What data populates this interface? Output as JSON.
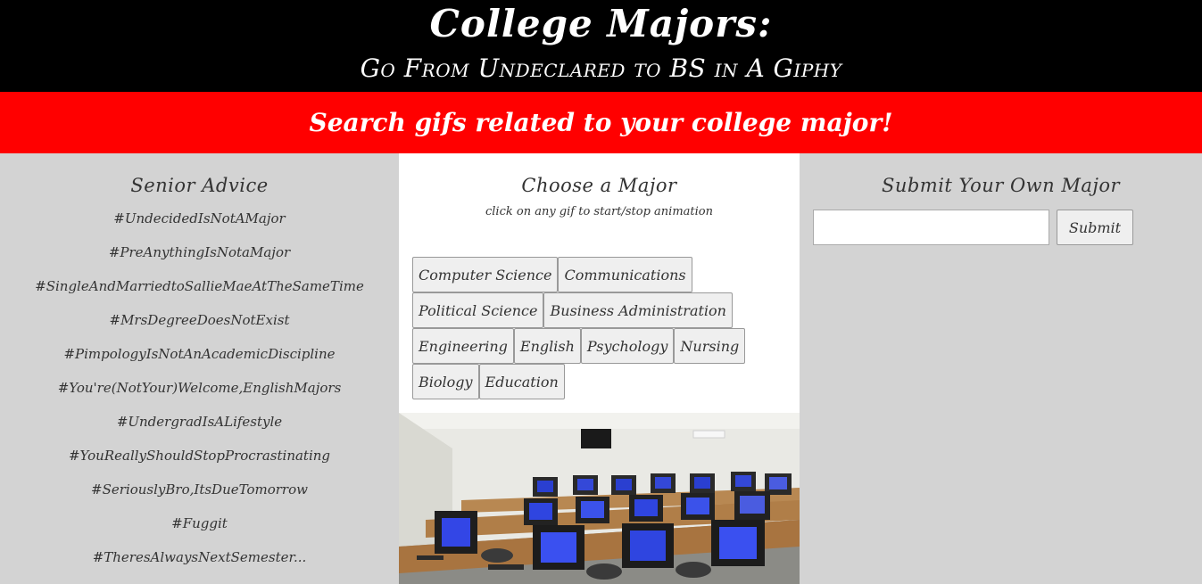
{
  "header": {
    "title": "College Majors:",
    "subtitle": "Go From Undeclared to BS in A Giphy"
  },
  "banner": {
    "text": "Search gifs related to your college major!"
  },
  "advice": {
    "heading": "Senior Advice",
    "items": [
      "#UndecidedIsNotAMajor",
      "#PreAnythingIsNotaMajor",
      "#SingleAndMarriedtoSallieMaeAtTheSameTime",
      "#MrsDegreeDoesNotExist",
      "#PimpologyIsNotAnAcademicDiscipline",
      "#You're(NotYour)Welcome,EnglishMajors",
      "#UndergradIsALifestyle",
      "#YouReallyShouldStopProcrastinating",
      "#SeriouslyBro,ItsDueTomorrow",
      "#Fuggit",
      "#TheresAlwaysNextSemester..."
    ]
  },
  "majors": {
    "heading": "Choose a Major",
    "hint": "click on any gif to start/stop animation",
    "rows": [
      [
        "Computer Science",
        "Communications"
      ],
      [
        "Political Science",
        "Business Administration"
      ],
      [
        "Engineering",
        "English",
        "Psychology",
        "Nursing"
      ],
      [
        "Biology",
        "Education"
      ]
    ]
  },
  "submit": {
    "heading": "Submit Your Own Major",
    "input_value": "",
    "button_label": "Submit"
  }
}
